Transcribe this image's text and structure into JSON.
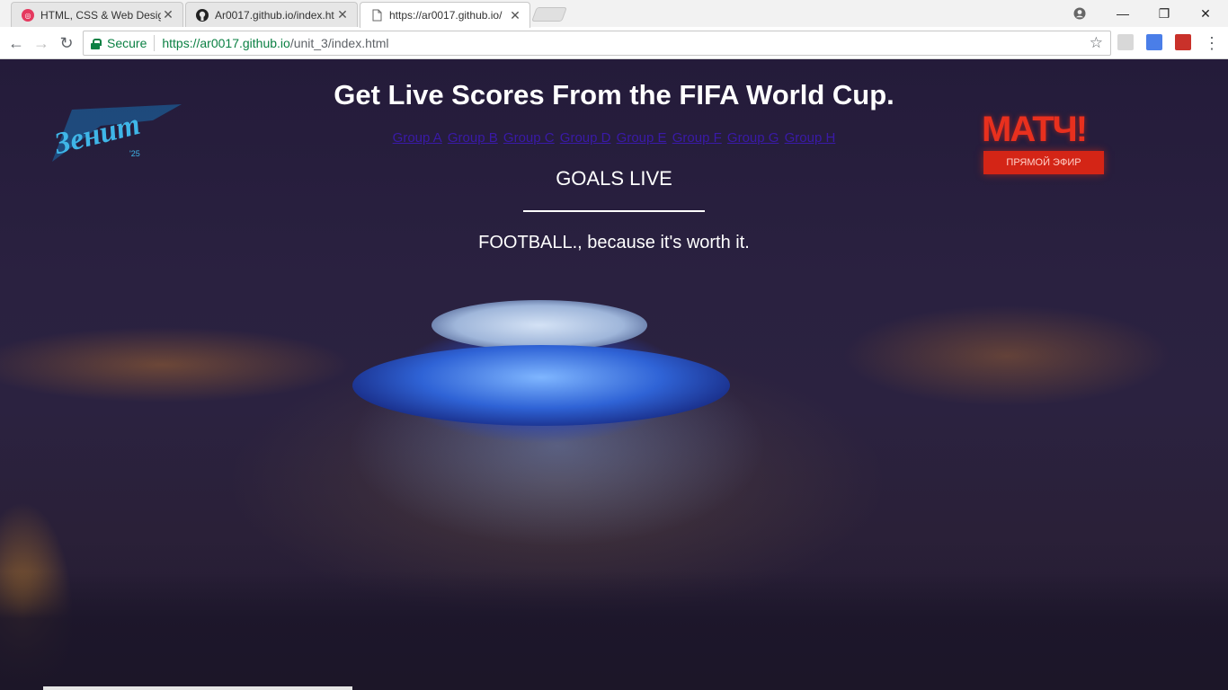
{
  "browser": {
    "tabs": [
      {
        "title": "HTML, CSS & Web Desig",
        "favicon": "codecademy-icon",
        "active": false
      },
      {
        "title": "Ar0017.github.io/index.ht",
        "favicon": "github-icon",
        "active": false
      },
      {
        "title": "https://ar0017.github.io/",
        "favicon": "page-icon",
        "active": true
      }
    ],
    "window_controls": {
      "minimize": "—",
      "maximize": "❐",
      "close": "✕"
    },
    "nav": {
      "back": "←",
      "forward": "→",
      "reload": "↻"
    },
    "secure_label": "Secure",
    "url": {
      "scheme": "https://",
      "host": "ar0017.github.io",
      "path": "/unit_3/index.html"
    },
    "star": "☆",
    "menu": "⋮"
  },
  "page": {
    "title": "Get Live Scores From the FIFA World Cup.",
    "groups": [
      "Group A",
      "Group B",
      "Group C",
      "Group D",
      "Group E",
      "Group F",
      "Group G",
      "Group H"
    ],
    "subtitle": "GOALS LIVE",
    "tagline": "FOOTBALL., because it's worth it.",
    "logo_left_text": "Зенит",
    "logo_right_brand": "МАТЧ!",
    "logo_right_sub": "ПРЯМОЙ ЭФИР"
  },
  "colors": {
    "link": "#3a1aa8",
    "secure": "#0b8043",
    "match_red": "#e8301e",
    "zenit_blue": "#3fb6e8"
  }
}
